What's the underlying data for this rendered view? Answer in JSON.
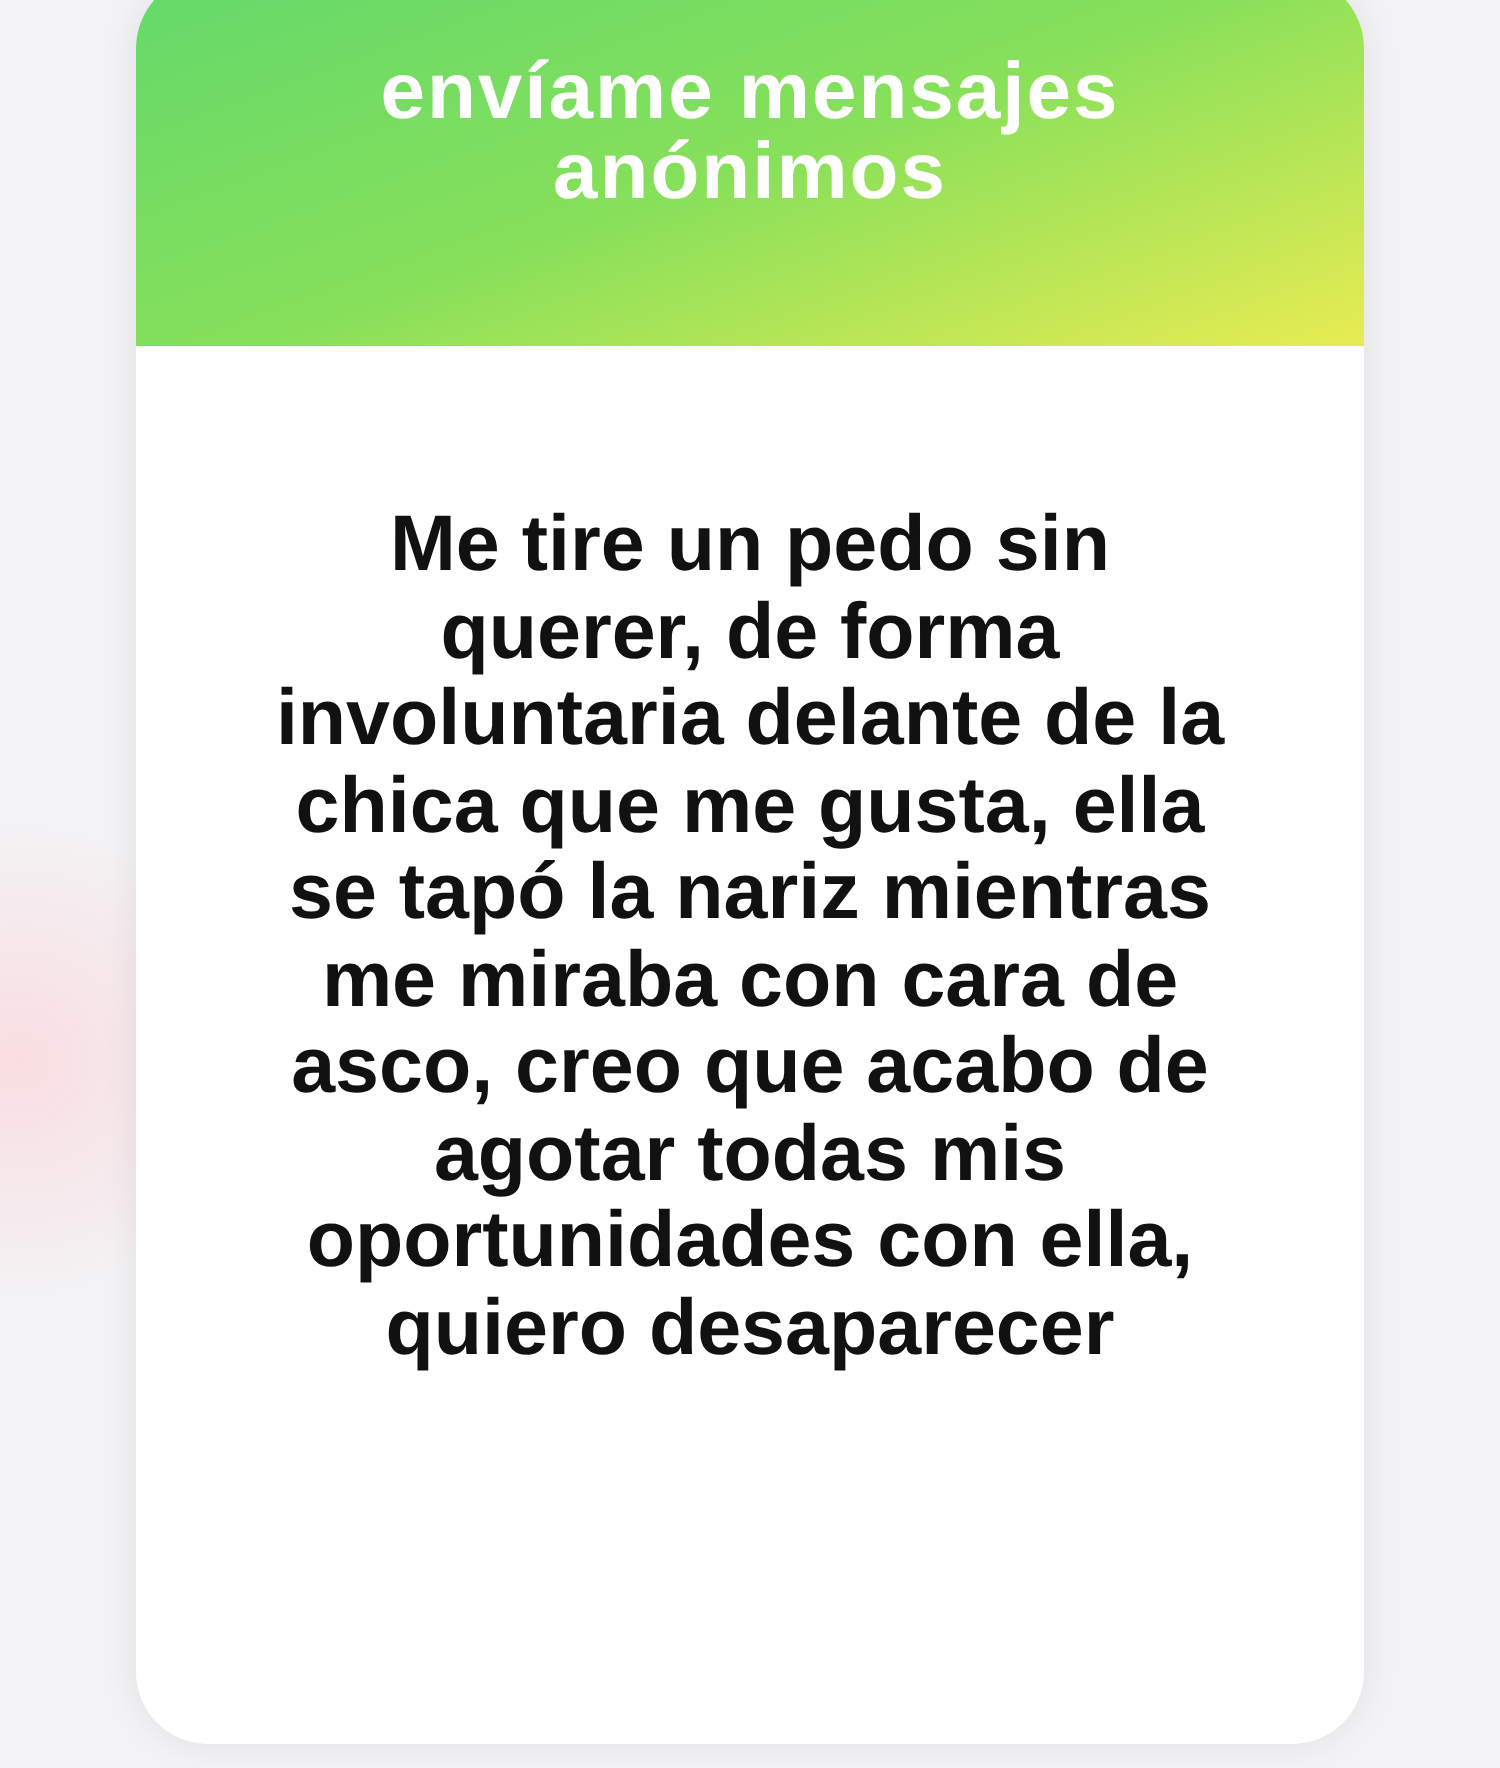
{
  "card": {
    "header_title": "envíame mensajes anónimos",
    "message": "Me tire un pedo sin querer, de forma involuntaria delante de la chica que me gusta, ella se tapó la nariz mientras me miraba con cara de asco, creo que acabo de agotar todas mis oportunidades con ella, quiero desaparecer"
  }
}
